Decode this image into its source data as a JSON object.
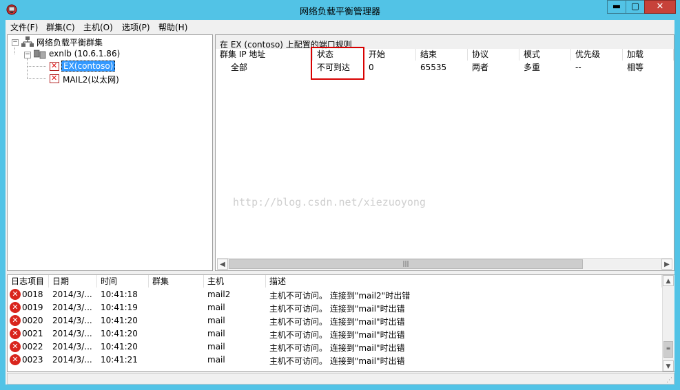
{
  "window": {
    "title": "网络负载平衡管理器",
    "minimize": "▬",
    "maximize": "▢",
    "close": "✕"
  },
  "menu": [
    "文件(F)",
    "群集(C)",
    "主机(O)",
    "选项(P)",
    "帮助(H)"
  ],
  "tree": {
    "root": "网络负载平衡群集",
    "cluster": "exnlb (10.6.1.86)",
    "hosts": [
      "EX(contoso)",
      "MAIL2(以太网)"
    ]
  },
  "port_rules": {
    "heading": "在 EX (contoso) 上配置的端口规则",
    "columns": [
      "群集 IP 地址",
      "状态",
      "开始",
      "结束",
      "协议",
      "模式",
      "优先级",
      "加载"
    ],
    "rows": [
      [
        "全部",
        "不可到达",
        "0",
        "65535",
        "两者",
        "多重",
        "--",
        "相等"
      ]
    ]
  },
  "watermark": "http://blog.csdn.net/xiezuoyong",
  "log": {
    "columns": [
      "日志项目",
      "日期",
      "时间",
      "群集",
      "主机",
      "描述"
    ],
    "rows": [
      [
        "0018",
        "2014/3/...",
        "10:41:18",
        "",
        "mail2",
        "主机不可访问。 连接到\"mail2\"时出错"
      ],
      [
        "0019",
        "2014/3/...",
        "10:41:19",
        "",
        "mail",
        "主机不可访问。 连接到\"mail\"时出错"
      ],
      [
        "0020",
        "2014/3/...",
        "10:41:20",
        "",
        "mail",
        "主机不可访问。 连接到\"mail\"时出错"
      ],
      [
        "0021",
        "2014/3/...",
        "10:41:20",
        "",
        "mail",
        "主机不可访问。 连接到\"mail\"时出错"
      ],
      [
        "0022",
        "2014/3/...",
        "10:41:20",
        "",
        "mail",
        "主机不可访问。 连接到\"mail\"时出错"
      ],
      [
        "0023",
        "2014/3/...",
        "10:41:21",
        "",
        "mail",
        "主机不可访问。 连接到\"mail\"时出错"
      ]
    ]
  },
  "colors": {
    "title_bar": "#52c3e6",
    "close_button": "#c7423a",
    "selection": "#3399ff",
    "highlight_box": "#d80000",
    "error": "#d9251d"
  }
}
